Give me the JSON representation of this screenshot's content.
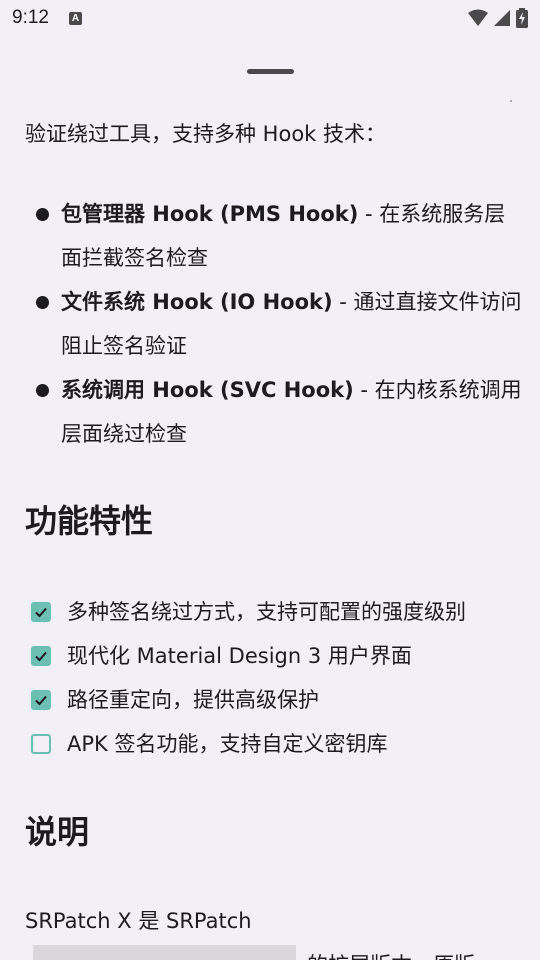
{
  "status_bar": {
    "time": "9:12",
    "notification_icon": "a-icon",
    "icons": [
      "wifi-icon",
      "signal-icon",
      "battery-charging-icon"
    ]
  },
  "intro": "验证绕过工具，支持多种 Hook 技术：",
  "hooks": [
    {
      "title": "包管理器 Hook (PMS Hook)",
      "desc": " - 在系统服务层面拦截签名检查"
    },
    {
      "title": "文件系统 Hook (IO Hook)",
      "desc": " - 通过直接文件访问阻止签名验证"
    },
    {
      "title": "系统调用 Hook (SVC Hook)",
      "desc": " - 在内核系统调用层面绕过检查"
    }
  ],
  "features_heading": "功能特性",
  "features": [
    {
      "label": "多种签名绕过方式，支持可配置的强度级别",
      "checked": true
    },
    {
      "label": "现代化 Material Design 3 用户界面",
      "checked": true
    },
    {
      "label": "路径重定向，提供高级保护",
      "checked": true
    },
    {
      "label": "APK 签名功能，支持自定义密钥库",
      "checked": false
    }
  ],
  "description_heading": "说明",
  "description_line1": "SRPatch X 是 SRPatch",
  "description_line2_visible": "的扩展版本，原版",
  "colors": {
    "background": "#f3eff6",
    "checkbox": "#6cbfb3",
    "text": "#1c1b1f"
  }
}
